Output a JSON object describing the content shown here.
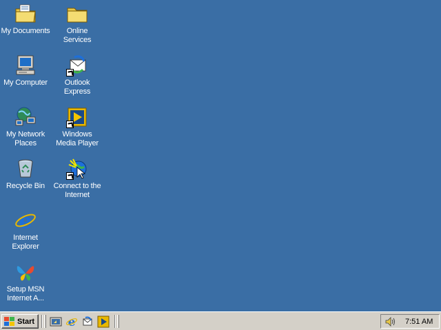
{
  "desktop": {
    "background_color": "#3A6EA5",
    "icons": [
      {
        "label": "My Documents",
        "icon": "my-documents-icon"
      },
      {
        "label": "Online Services",
        "icon": "folder-icon"
      },
      {
        "label": "My Computer",
        "icon": "my-computer-icon"
      },
      {
        "label": "Outlook Express",
        "icon": "outlook-express-icon"
      },
      {
        "label": "My Network Places",
        "icon": "network-places-icon"
      },
      {
        "label": "Windows Media Player",
        "icon": "media-player-icon"
      },
      {
        "label": "Recycle Bin",
        "icon": "recycle-bin-icon"
      },
      {
        "label": "Connect to the Internet",
        "icon": "connect-internet-icon"
      },
      {
        "label": "Internet Explorer",
        "icon": "internet-explorer-icon"
      },
      {
        "label": "Setup MSN Internet A...",
        "icon": "msn-butterfly-icon"
      }
    ]
  },
  "taskbar": {
    "start_label": "Start",
    "quick_launch": [
      "show-desktop-icon",
      "internet-explorer-icon",
      "outlook-express-icon",
      "media-player-icon"
    ],
    "tray": {
      "volume_icon": "speaker-icon",
      "clock": "7:51 AM"
    }
  }
}
